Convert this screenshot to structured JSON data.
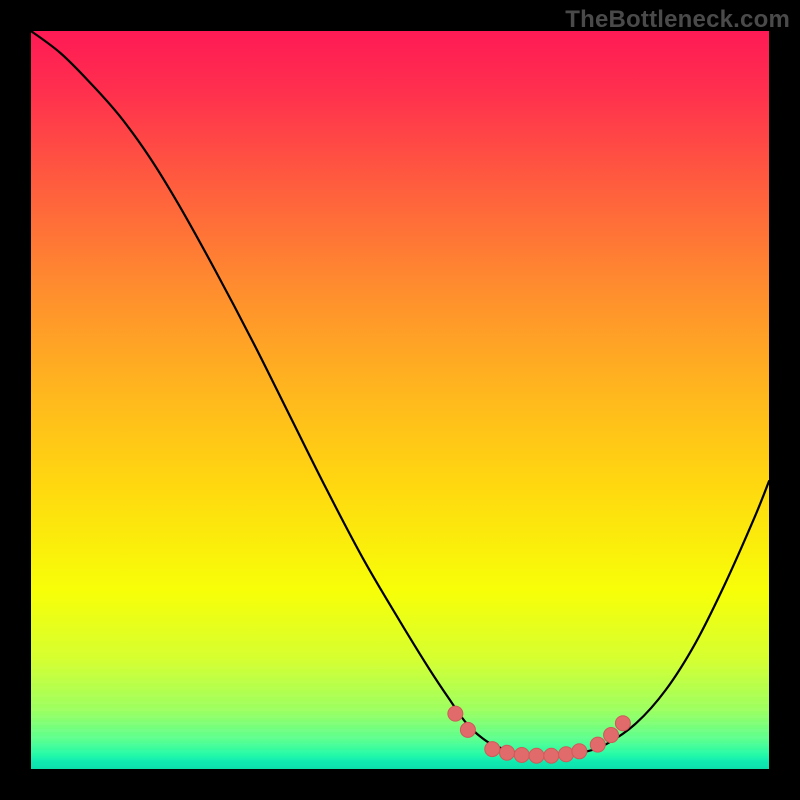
{
  "attribution": "TheBottleneck.com",
  "colors": {
    "page_bg": "#000000",
    "attribution_text": "#4a4a4a",
    "curve_stroke": "#000000",
    "marker_fill": "#e16a6a",
    "marker_stroke": "#cf5a5a"
  },
  "chart_data": {
    "type": "line",
    "title": "",
    "xlabel": "",
    "ylabel": "",
    "xlim": [
      0,
      100
    ],
    "ylim": [
      0,
      100
    ],
    "grid": false,
    "legend": false,
    "series": [
      {
        "name": "bottleneck-curve",
        "x": [
          0,
          4,
          8,
          12,
          16,
          20,
          25,
          30,
          35,
          40,
          45,
          50,
          54,
          57,
          59,
          61,
          63,
          66,
          69,
          72,
          75,
          78,
          82,
          86,
          90,
          94,
          98,
          100
        ],
        "y": [
          100,
          97,
          93,
          88.5,
          83,
          76.5,
          67.5,
          58,
          48,
          38,
          28.5,
          20,
          13.5,
          9,
          6.2,
          4.3,
          3.1,
          2.2,
          1.8,
          1.8,
          2.3,
          3.4,
          6.2,
          10.7,
          17,
          25,
          34,
          39
        ]
      }
    ],
    "markers": [
      {
        "name": "left-cluster-top",
        "x": 57.5,
        "y": 7.5
      },
      {
        "name": "left-cluster-mid",
        "x": 59.2,
        "y": 5.3
      },
      {
        "name": "flat-start",
        "x": 62.5,
        "y": 2.7
      },
      {
        "name": "flat-a",
        "x": 64.5,
        "y": 2.2
      },
      {
        "name": "flat-b",
        "x": 66.5,
        "y": 1.9
      },
      {
        "name": "flat-c",
        "x": 68.5,
        "y": 1.8
      },
      {
        "name": "flat-d",
        "x": 70.5,
        "y": 1.8
      },
      {
        "name": "flat-e",
        "x": 72.5,
        "y": 2.0
      },
      {
        "name": "flat-end",
        "x": 74.3,
        "y": 2.4
      },
      {
        "name": "right-cluster-low",
        "x": 76.8,
        "y": 3.3
      },
      {
        "name": "right-cluster-mid",
        "x": 78.6,
        "y": 4.6
      },
      {
        "name": "right-cluster-top",
        "x": 80.2,
        "y": 6.2
      }
    ]
  }
}
